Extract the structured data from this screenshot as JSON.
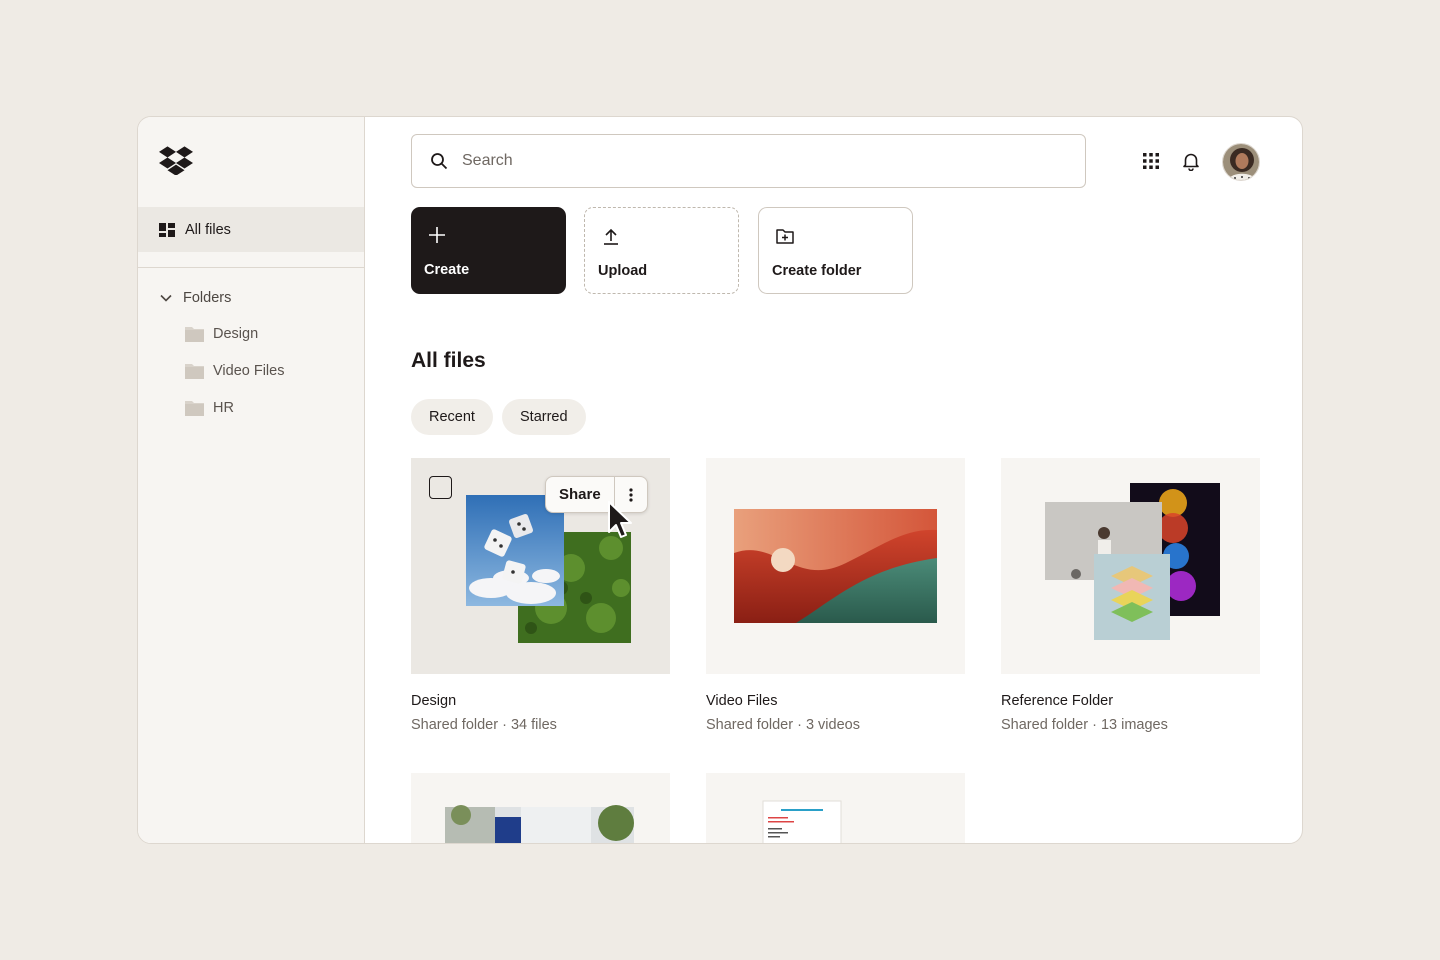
{
  "sidebar": {
    "nav_all_files": "All files",
    "folders_heading": "Folders",
    "folders": [
      {
        "label": "Design",
        "icon": "folder-icon"
      },
      {
        "label": "Video Files",
        "icon": "folder-icon"
      },
      {
        "label": "HR",
        "icon": "folder-icon"
      }
    ]
  },
  "header": {
    "search_placeholder": "Search",
    "icons": [
      "search-icon",
      "apps-grid-icon",
      "bell-icon"
    ]
  },
  "actions": {
    "create_label": "Create",
    "upload_label": "Upload",
    "create_folder_label": "Create folder"
  },
  "main": {
    "title": "All files",
    "filters": [
      "Recent",
      "Starred"
    ],
    "cards": [
      {
        "name": "Design",
        "meta": "Shared folder · 34 files"
      },
      {
        "name": "Video Files",
        "meta": "Shared folder · 3 videos"
      },
      {
        "name": "Reference Folder",
        "meta": "Shared folder · 13 images"
      }
    ],
    "hover_share_label": "Share"
  },
  "colors": {
    "background": "#efebe5",
    "primary_button": "#1e1919",
    "sidebar_bg": "#f7f5f2",
    "brand": "#1e1919"
  }
}
